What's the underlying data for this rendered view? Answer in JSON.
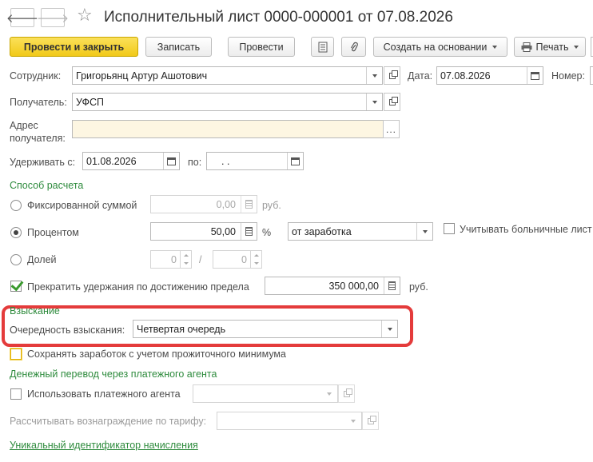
{
  "window": {
    "title": "Исполнительный лист 0000-000001 от 07.08.2026",
    "back_icon": "arrow-left-icon",
    "forward_icon": "arrow-right-icon",
    "favorite_icon": "star-icon"
  },
  "toolbar": {
    "post_close": "Провести и закрыть",
    "save": "Записать",
    "post": "Провести",
    "create_based": "Создать на основании",
    "print": "Печать"
  },
  "form": {
    "employee": {
      "label": "Сотрудник:",
      "value": "Григорьянц Артур Ашотович"
    },
    "date": {
      "label": "Дата:",
      "value": "07.08.2026"
    },
    "number": {
      "label": "Номер:"
    },
    "recipient": {
      "label": "Получатель:",
      "value": "УФСП"
    },
    "address": {
      "label_1": "Адрес",
      "label_2": "получателя:",
      "value": ""
    },
    "withhold_from": {
      "label": "Удерживать с:",
      "value": "01.08.2026"
    },
    "withhold_to": {
      "label": "по:",
      "value": " .  ."
    }
  },
  "calc_method": {
    "header": "Способ расчета",
    "fixed": {
      "label": "Фиксированной суммой",
      "value": "0,00",
      "unit": "руб.",
      "selected": false
    },
    "percent": {
      "label": "Процентом",
      "value": "50,00",
      "unit": "%",
      "base": "от заработка",
      "selected": true
    },
    "share": {
      "label": "Долей",
      "numerator": "0",
      "separator": "/",
      "denominator": "0",
      "selected": false
    },
    "sick_leave": {
      "label": "Учитывать больничные лист",
      "checked": false
    },
    "stop_limit": {
      "label": "Прекратить удержания по достижению предела",
      "value": "350 000,00",
      "unit": "руб.",
      "checked": true
    }
  },
  "collection": {
    "header": "Взыскание",
    "priority_label": "Очередность взыскания:",
    "priority_value": "Четвертая очередь"
  },
  "keep_min": {
    "label": "Сохранять заработок с учетом прожиточного минимума",
    "checked": false
  },
  "agent": {
    "header": "Денежный перевод через платежного агента",
    "use_label": "Использовать платежного агента",
    "fee_label": "Рассчитывать вознаграждение по тарифу:"
  },
  "uid_link": "Уникальный идентификатор начисления",
  "colors": {
    "accent": "#f1c919",
    "green": "#2e8b3d",
    "highlight": "#e43b3b"
  }
}
